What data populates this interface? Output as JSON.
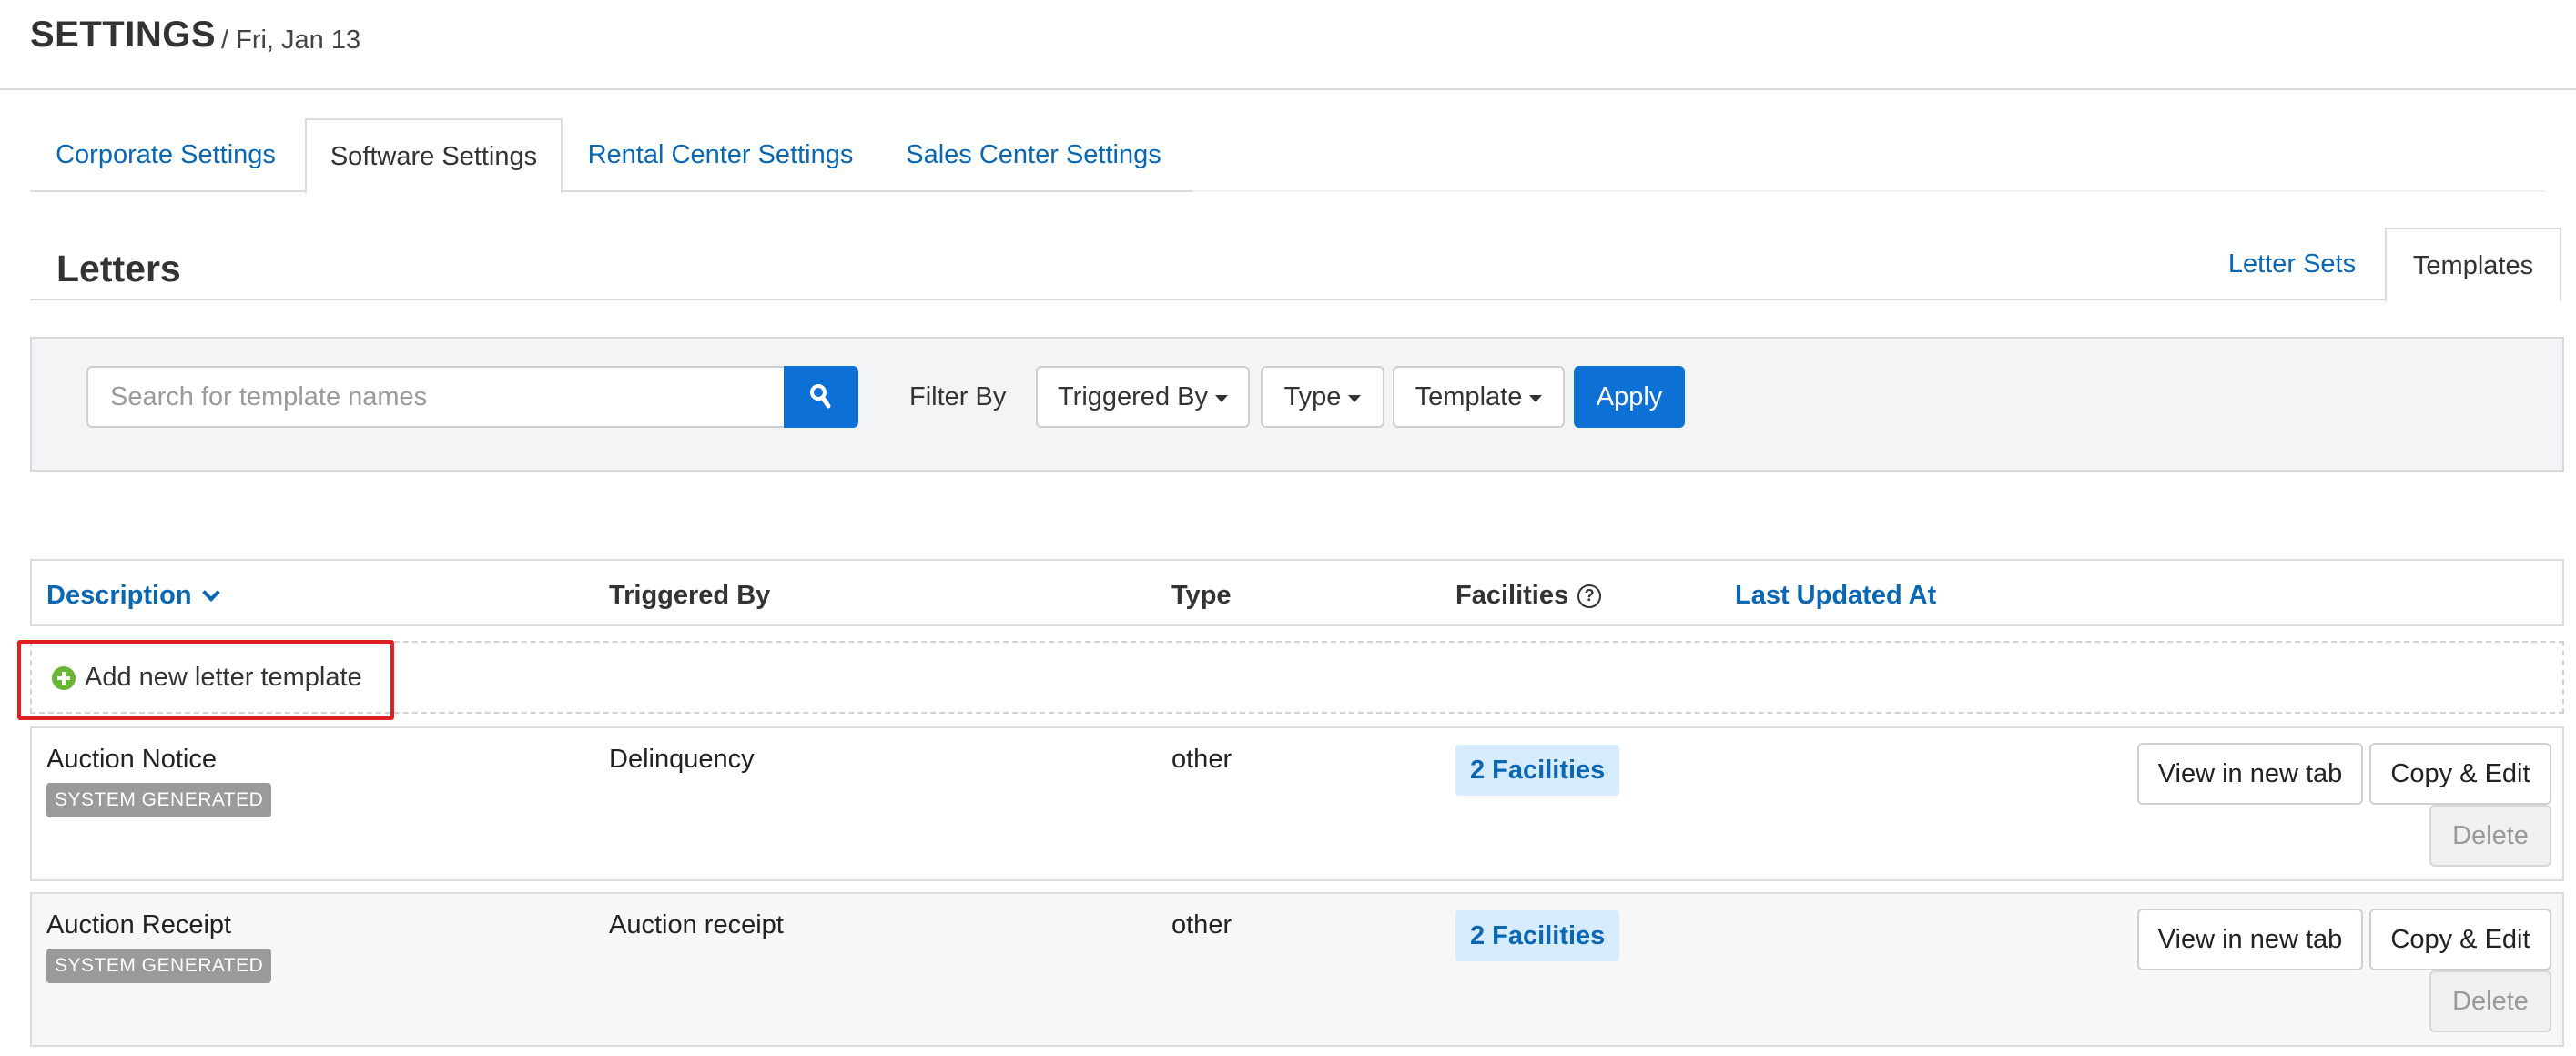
{
  "header": {
    "title": "SETTINGS",
    "date": "/ Fri, Jan 13"
  },
  "main_tabs": [
    {
      "label": "Corporate Settings",
      "active": false
    },
    {
      "label": "Software Settings",
      "active": true
    },
    {
      "label": "Rental Center Settings",
      "active": false
    },
    {
      "label": "Sales Center Settings",
      "active": false
    }
  ],
  "section": {
    "title": "Letters",
    "tabs": [
      {
        "label": "Letter Sets",
        "active": false
      },
      {
        "label": "Templates",
        "active": true
      }
    ]
  },
  "filters": {
    "search_placeholder": "Search for template names",
    "search_value": "",
    "filter_label": "Filter By",
    "dropdowns": [
      "Triggered By",
      "Type",
      "Template"
    ],
    "apply_label": "Apply"
  },
  "table": {
    "columns": {
      "description": "Description",
      "triggered_by": "Triggered By",
      "type": "Type",
      "facilities": "Facilities",
      "facilities_help": "?",
      "last_updated": "Last Updated At"
    },
    "add_label": "Add new letter template",
    "rows": [
      {
        "description": "Auction Notice",
        "badge": "SYSTEM GENERATED",
        "triggered_by": "Delinquency",
        "type": "other",
        "facilities": "2 Facilities",
        "view_label": "View in new tab",
        "copy_label": "Copy & Edit",
        "delete_label": "Delete"
      },
      {
        "description": "Auction Receipt",
        "badge": "SYSTEM GENERATED",
        "triggered_by": "Auction receipt",
        "type": "other",
        "facilities": "2 Facilities",
        "view_label": "View in new tab",
        "copy_label": "Copy & Edit",
        "delete_label": "Delete"
      }
    ]
  },
  "colors": {
    "link": "#0a67b4",
    "primary_button": "#0d70d4",
    "add_icon": "#6ab536",
    "highlight": "#e02020",
    "badge_gray": "#9a9a9a",
    "facility_badge_bg": "#d6ebfb"
  },
  "icons": {
    "search_button": "search-icon",
    "description_sort": "chevron-down-icon",
    "facilities_help": "question-circle-icon",
    "add_template": "plus-circle-icon",
    "dropdown": "caret-down-icon"
  }
}
